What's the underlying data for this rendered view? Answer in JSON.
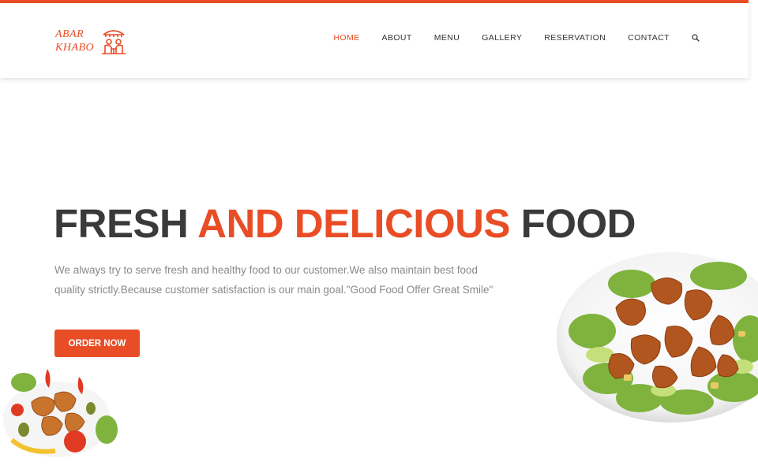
{
  "brand": {
    "line1": "ABAR",
    "line2": "KHABO"
  },
  "nav": {
    "items": [
      {
        "label": "HOME",
        "active": true
      },
      {
        "label": "ABOUT",
        "active": false
      },
      {
        "label": "MENU",
        "active": false
      },
      {
        "label": "GALLERY",
        "active": false
      },
      {
        "label": "RESERVATION",
        "active": false
      },
      {
        "label": "CONTACT",
        "active": false
      }
    ],
    "search_icon": "search-icon"
  },
  "hero": {
    "title_part1": "FRESH",
    "title_accent": "AND DELICIOUS",
    "title_part2": "FOOD",
    "description": "We always try to serve fresh and healthy food to our customer.We also maintain best food quality strictly.Because customer satisfaction is our main goal.\"Good Food Offer Great Smile\"",
    "cta_label": "ORDER NOW"
  },
  "colors": {
    "accent": "#e94d26",
    "text_dark": "#3a3a3a",
    "text_muted": "#8a8a8a"
  }
}
